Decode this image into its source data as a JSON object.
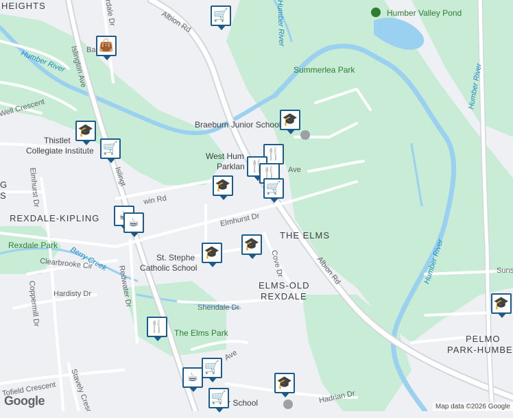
{
  "map": {
    "neighbourhoods": {
      "heights": "HEIGHTS",
      "rexdale_kipling": "REXDALE-KIPLING",
      "the_elms": "THE ELMS",
      "elms_old_line1": "ELMS-OLD",
      "elms_old_line2": "REXDALE",
      "pelmo_line1": "PELMO",
      "pelmo_line2": "PARK-HUMBERL",
      "edge_gs": "G",
      "edge_s": "S"
    },
    "parks": {
      "humber_valley_pond": "Humber Valley Pond",
      "summerlea_park": "Summerlea Park",
      "rexdale_park": "Rexdale Park",
      "elms_park": "The Elms Park"
    },
    "places": {
      "braeburn": "Braeburn Junior School",
      "west_humber_1": "West Hum",
      "west_humber_2": "Parklan",
      "thistletown_1": "Thistlet",
      "thistletown_2": "Collegiate Institute",
      "st_stephen_1": "St. Stephe",
      "st_stephen_2": "Catholic School",
      "junior_school": "nior School"
    },
    "water": {
      "humber_river_left": "Humber River",
      "humber_river_right": "Humber River",
      "humber_river_top": "Humber River",
      "humber_river_lower": "Humber River",
      "berry_creek": "Berry Creek"
    },
    "roads": {
      "albion_top": "Albion Rd",
      "albion_bottom": "Albion Rd",
      "islington_1": "Islington Ave",
      "islington_2": "Islingt",
      "elmhurst_dr": "Elmhurst Dr",
      "elmhurst_dr_left": "Elmhurst Dr",
      "redwater_dr": "Redwater Dr",
      "cove_dr": "Cove Dr",
      "shendale_dr": "Shendale Dr",
      "clearbrooke": "Clearbrooke Cir",
      "hardisty": "Hardisty Dr",
      "coppermill": "Coppermill Dr",
      "tofield": "Tofield Crescent",
      "stavely": "Stavely Cresc",
      "hadrian": "Hadrian Dr",
      "well_crescent": "Well Crescent",
      "ossendale": "rdale Dr",
      "sunset": "Suns",
      "win_rd": "win Rd",
      "ave_1": "Ave",
      "ave_2": "Ave",
      "ba": "Ba"
    },
    "pins": [
      {
        "icon": "🛒",
        "name": "grocery-pin"
      },
      {
        "icon": "👜",
        "name": "shopping-pin"
      },
      {
        "icon": "🎓",
        "name": "school-pin"
      },
      {
        "icon": "🛒",
        "name": "grocery-pin"
      },
      {
        "icon": "🎓",
        "name": "school-pin"
      },
      {
        "icon": "🍴",
        "name": "restaurant-pin"
      },
      {
        "icon": "🍴",
        "name": "restaurant-pin"
      },
      {
        "icon": "🍴",
        "name": "restaurant-pin"
      },
      {
        "icon": "🛒",
        "name": "grocery-pin"
      },
      {
        "icon": "🎓",
        "name": "school-pin"
      },
      {
        "icon": "☕",
        "name": "cafe-pin"
      },
      {
        "icon": "☕",
        "name": "cafe-pin"
      },
      {
        "icon": "🎓",
        "name": "school-pin"
      },
      {
        "icon": "🎓",
        "name": "school-pin"
      },
      {
        "icon": "🍴",
        "name": "restaurant-pin"
      },
      {
        "icon": "☕",
        "name": "cafe-pin"
      },
      {
        "icon": "🛒",
        "name": "grocery-pin"
      },
      {
        "icon": "🛒",
        "name": "grocery-pin"
      },
      {
        "icon": "🎓",
        "name": "school-pin"
      },
      {
        "icon": "🎓",
        "name": "school-pin"
      }
    ],
    "colors": {
      "park": "#c8ecd5",
      "water": "#9ad0f0",
      "road": "#ffffff",
      "arterial": "#d3d7dc",
      "pin_border": "#1b5b8c"
    }
  },
  "footer": {
    "logo": "Google",
    "attribution": "Map data ©2026 Google"
  }
}
